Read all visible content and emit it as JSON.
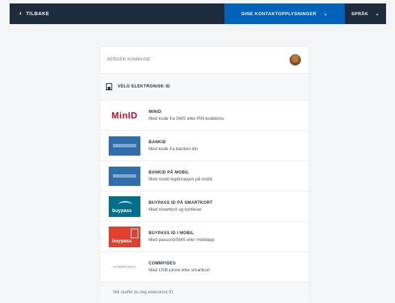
{
  "topbar": {
    "back_label": "TILBAKE",
    "contact_label": "DINE KONTAKTOPPLYSNINGER",
    "language_label": "SPRÅK"
  },
  "colors": {
    "topbar_bg": "#1e2b3c",
    "accent_blue": "#0062ba",
    "page_bg": "#f4f5f6",
    "minid_red": "#c8102e",
    "buypass_teal": "#006f8c",
    "buypass_red": "#e0402e",
    "bankid_blue": "#2f6ea9"
  },
  "card": {
    "organization": "BERGEN KOMMUNE",
    "choose_heading": "VELG ELEKTRONISK ID",
    "options": [
      {
        "logo_text": "MinID",
        "title": "MINID",
        "subtitle": "Med kode fra SMS eller PIN-kodebrev"
      },
      {
        "logo_text": "",
        "title": "BANKID",
        "subtitle": "Med kode fra banken din"
      },
      {
        "logo_text": "",
        "title": "BANKID PÅ MOBIL",
        "subtitle": "Med mobil legitimasjon på mobil"
      },
      {
        "logo_text": "buypass",
        "title": "BUYPASS ID PÅ SMARTKORT",
        "subtitle": "Med smartkort og kortleser"
      },
      {
        "logo_text": "buypass",
        "title": "BUYPASS ID I MOBIL",
        "subtitle": "Med passord/SMS eller mobilapp"
      },
      {
        "logo_text": "COMMFIDES",
        "title": "COMMFIDES",
        "subtitle": "Med USB-pinne eller smartkort"
      }
    ],
    "footer_link": "Slik skaffer du deg elektronisk ID"
  }
}
